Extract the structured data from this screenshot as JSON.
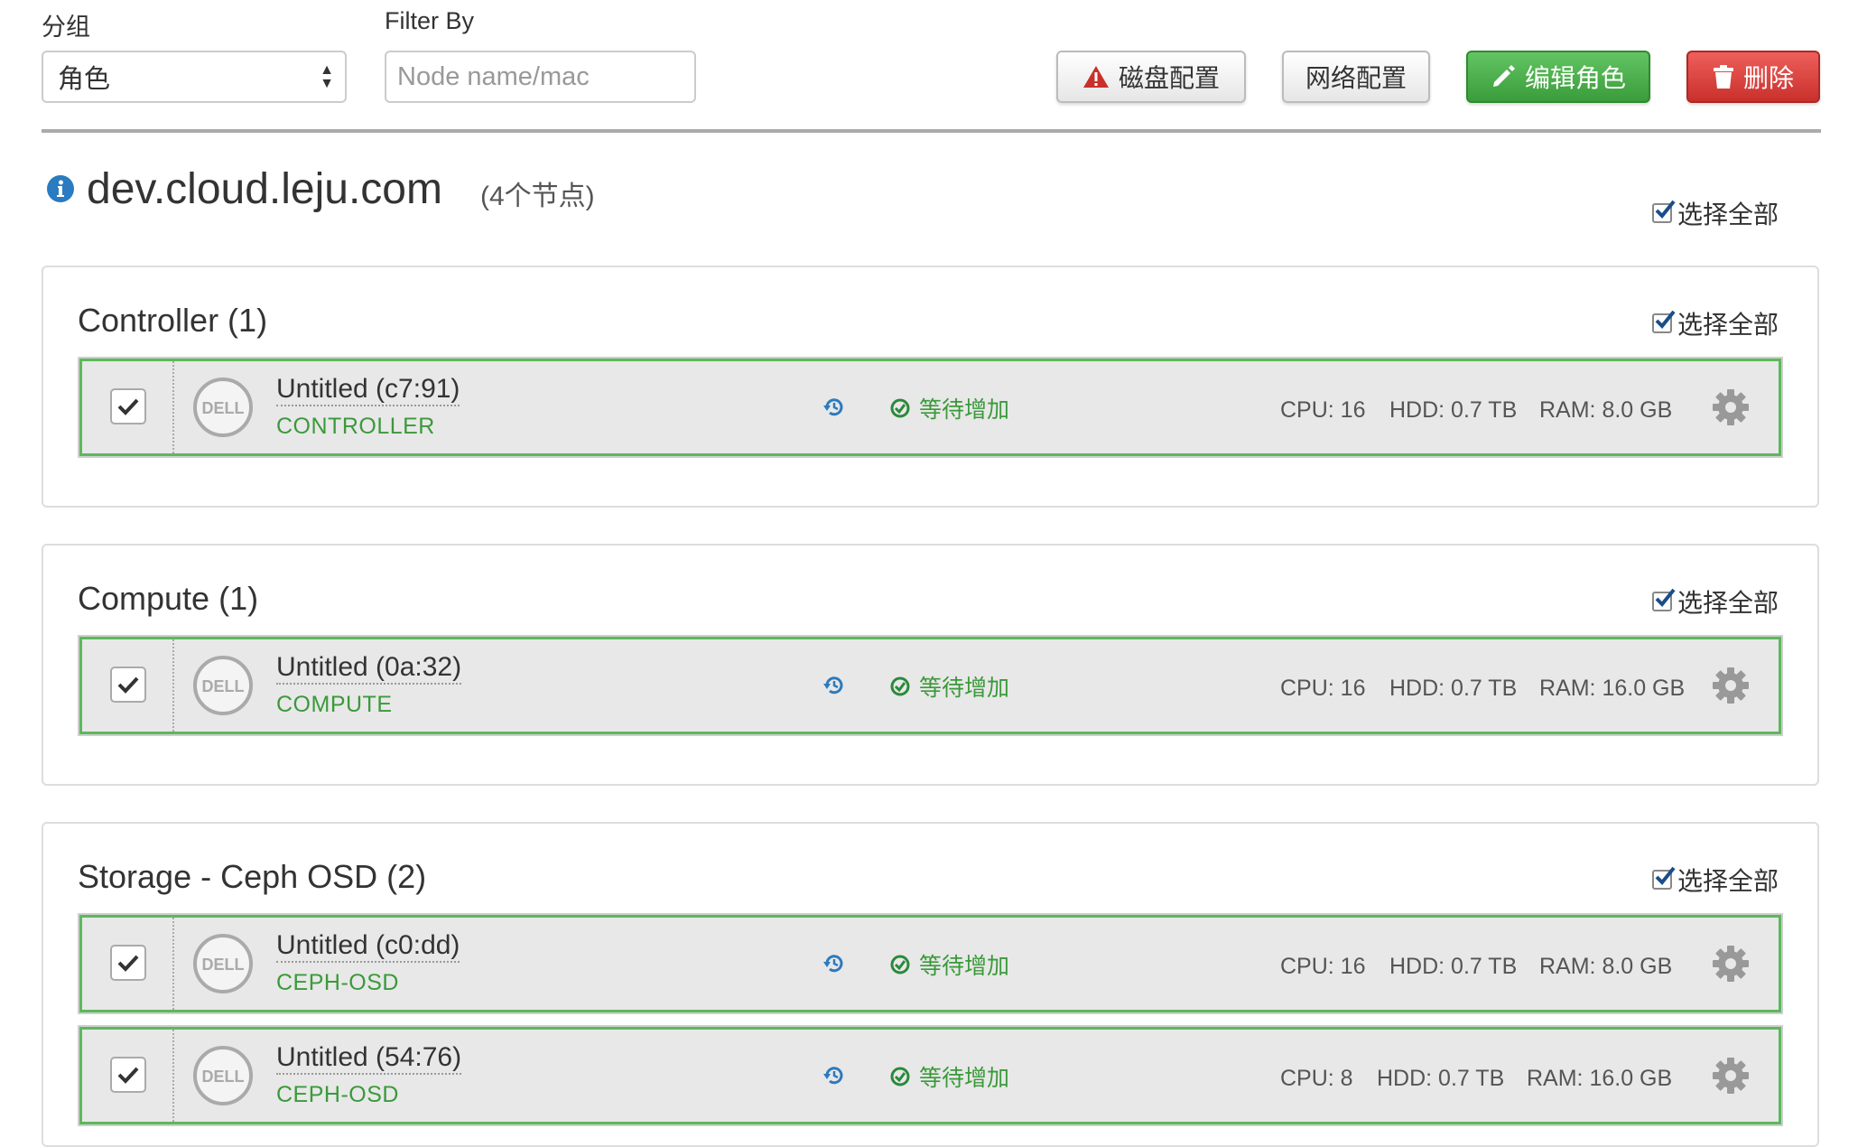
{
  "toolbar": {
    "group_label": "分组",
    "group_value": "角色",
    "filter_label": "Filter By",
    "filter_placeholder": "Node name/mac",
    "disk_config": "磁盘配置",
    "network_config": "网络配置",
    "edit_roles": "编辑角色",
    "delete": "删除"
  },
  "cluster": {
    "name": "dev.cloud.leju.com",
    "node_count": "(4个节点)",
    "select_all": "选择全部"
  },
  "groups": [
    {
      "title": "Controller (1)",
      "select_all": "选择全部",
      "nodes": [
        {
          "name": "Untitled (c7:91)",
          "role": "CONTROLLER",
          "status": "等待增加",
          "cpu": "CPU: 16",
          "hdd": "HDD: 0.7 TB",
          "ram": "RAM: 8.0 GB"
        }
      ]
    },
    {
      "title": "Compute (1)",
      "select_all": "选择全部",
      "nodes": [
        {
          "name": "Untitled (0a:32)",
          "role": "COMPUTE",
          "status": "等待增加",
          "cpu": "CPU: 16",
          "hdd": "HDD: 0.7 TB",
          "ram": "RAM: 16.0 GB"
        }
      ]
    },
    {
      "title": "Storage - Ceph OSD (2)",
      "select_all": "选择全部",
      "nodes": [
        {
          "name": "Untitled (c0:dd)",
          "role": "CEPH-OSD",
          "status": "等待增加",
          "cpu": "CPU: 16",
          "hdd": "HDD: 0.7 TB",
          "ram": "RAM: 8.0 GB"
        },
        {
          "name": "Untitled (54:76)",
          "role": "CEPH-OSD",
          "status": "等待增加",
          "cpu": "CPU: 8",
          "hdd": "HDD: 0.7 TB",
          "ram": "RAM: 16.0 GB"
        }
      ]
    }
  ],
  "logo_text": "DELL",
  "colors": {
    "success": "#5cb85c",
    "danger": "#d9534f",
    "status_green": "#3a9a3a",
    "info_blue": "#2a7bbf",
    "warning_red": "#c9302c"
  }
}
